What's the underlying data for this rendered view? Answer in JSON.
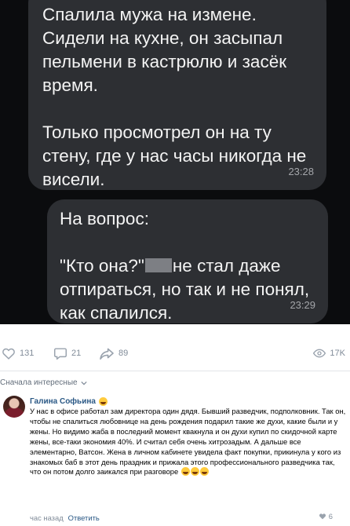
{
  "chat": {
    "message_1": "Спалила мужа на измене.\nСидели на кухне, он засыпал\nпельмени в кастрюлю и засёк\nвремя.\n\nТолько просмотрел он на ту\nстену, где у нас часы никогда не\nвисели.",
    "time_1": "23:28",
    "message_2_part1": "На вопрос:\n\n\"Кто она?\"",
    "message_2_part2": "не стал даже\nотпираться, но так и не понял,\nкак спалился.",
    "time_2": "23:29"
  },
  "post_stats": {
    "likes": "131",
    "comments": "21",
    "shares": "89",
    "views": "17K"
  },
  "comments_section": {
    "sort_label": "Сначала интересные",
    "comment": {
      "author": "Галина Софьина",
      "text": "У нас в офисе работал зам директора один дядя. Бывший разведчик, подполковник. Так он, чтобы не спалиться любовнице на день рождения подарил такие же духи, какие были и у жены. Но видимо жаба в последний момент квакнула и он духи купил по скидочной карте жены, все-таки экономия 40%. И считал себя очень хитрозадым. А дальше все элементарно, Ватсон. Жена в личном кабинете увидела факт покупки, прикинула у кого из знакомых баб в этот день праздник и прижала этого профессионального разведчика так, что он потом долго заикался при разговоре",
      "time": "час назад",
      "reply_label": "Ответить",
      "likes": "6"
    }
  },
  "colors": {
    "chat_bg": "#0b0c0e",
    "bubble": "#2d2f33",
    "link": "#2a5885",
    "muted": "#818c99"
  },
  "icons": [
    "heart-icon",
    "comment-icon",
    "share-icon",
    "eye-icon",
    "chevron-down-icon",
    "emoji-icon"
  ]
}
